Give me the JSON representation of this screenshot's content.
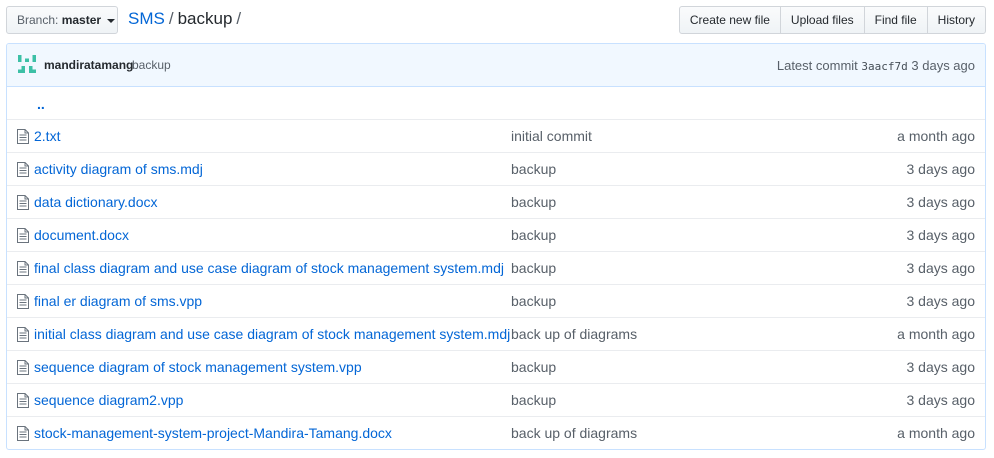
{
  "branch": {
    "label": "Branch:",
    "value": "master"
  },
  "breadcrumb": {
    "repo": "SMS",
    "separator": "/",
    "folder": "backup",
    "trailing": "/"
  },
  "actions": [
    "Create new file",
    "Upload files",
    "Find file",
    "History"
  ],
  "commit": {
    "author": "mandiratamang",
    "message": "backup",
    "latest_label": "Latest commit",
    "sha": "3aacf7d",
    "age": "3 days ago"
  },
  "parent_dir": "..",
  "files": [
    {
      "name": "2.txt",
      "message": "initial commit",
      "age": "a month ago"
    },
    {
      "name": "activity diagram of sms.mdj",
      "message": "backup",
      "age": "3 days ago"
    },
    {
      "name": "data dictionary.docx",
      "message": "backup",
      "age": "3 days ago"
    },
    {
      "name": "document.docx",
      "message": "backup",
      "age": "3 days ago"
    },
    {
      "name": "final class diagram and use case diagram of stock management system.mdj",
      "message": "backup",
      "age": "3 days ago"
    },
    {
      "name": "final er diagram of sms.vpp",
      "message": "backup",
      "age": "3 days ago"
    },
    {
      "name": "initial class diagram and use case diagram of stock management system.mdj",
      "message": "back up of diagrams",
      "age": "a month ago"
    },
    {
      "name": "sequence diagram of stock management system.vpp",
      "message": "backup",
      "age": "3 days ago"
    },
    {
      "name": "sequence diagram2.vpp",
      "message": "backup",
      "age": "3 days ago"
    },
    {
      "name": "stock-management-system-project-Mandira-Tamang.docx",
      "message": "back up of diagrams",
      "age": "a month ago"
    }
  ],
  "colors": {
    "link": "#0366d6",
    "muted": "#586069",
    "commit_bg": "#f1f8ff",
    "border": "#c8e1ff"
  },
  "icons": {
    "file": "file-text-icon",
    "dropdown": "caret-down-icon",
    "avatar": "identicon-avatar"
  }
}
